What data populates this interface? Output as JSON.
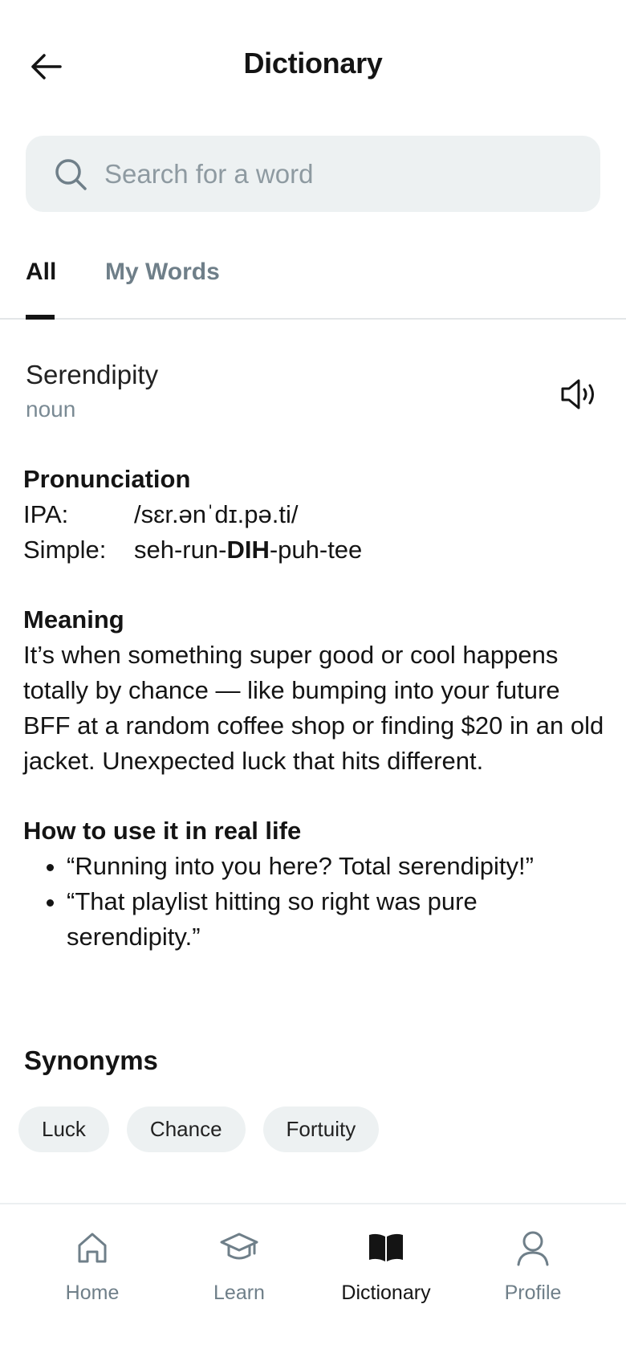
{
  "header": {
    "title": "Dictionary"
  },
  "search": {
    "placeholder": "Search for a word",
    "value": ""
  },
  "tabs": [
    {
      "label": "All",
      "active": true
    },
    {
      "label": "My Words",
      "active": false
    }
  ],
  "entry": {
    "word": "Serendipity",
    "part_of_speech": "noun",
    "pronunciation": {
      "heading": "Pronunciation",
      "ipa_label": "IPA:",
      "ipa": "/sɛr.ənˈdɪ.pə.ti/",
      "simple_label": "Simple:",
      "simple_before": "seh-run-",
      "simple_stress": "DIH",
      "simple_after": "-puh-tee"
    },
    "meaning": {
      "heading": "Meaning",
      "text": "It’s when something super good or cool happens totally by chance — like bumping into your future BFF at a random coffee shop or finding $20 in an old jacket. Unexpected luck that hits different."
    },
    "usage": {
      "heading": "How to use it in real life",
      "examples": [
        "“Running into you here? Total serendipity!”",
        "“That playlist hitting so right was pure serendipity.”"
      ]
    },
    "synonyms": {
      "heading": "Synonyms",
      "items": [
        "Luck",
        "Chance",
        "Fortuity"
      ]
    }
  },
  "bottom_nav": [
    {
      "label": "Home",
      "icon": "home-icon",
      "active": false
    },
    {
      "label": "Learn",
      "icon": "graduation-cap-icon",
      "active": false
    },
    {
      "label": "Dictionary",
      "icon": "book-icon",
      "active": true
    },
    {
      "label": "Profile",
      "icon": "user-icon",
      "active": false
    }
  ],
  "colors": {
    "accent": "#141414",
    "muted": "#6f7f89",
    "surface": "#edf1f2"
  }
}
